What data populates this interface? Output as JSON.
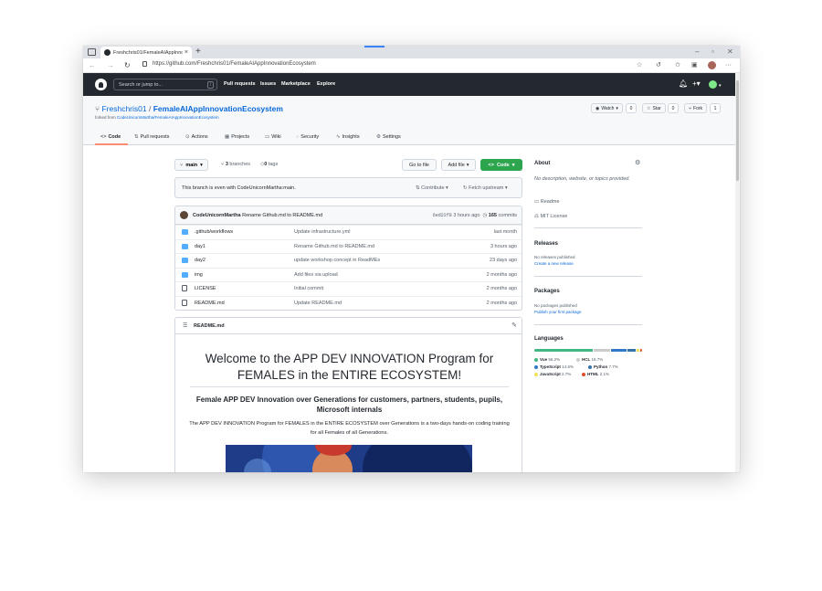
{
  "browser": {
    "tab_title": "Freshchris01/FemaleAIAppInno...",
    "url": "https://github.com/Freshchris01/FemaleAIAppInnovationEcosystem"
  },
  "gh": {
    "search_placeholder": "Search or jump to...",
    "search_key": "/",
    "nav": [
      "Pull requests",
      "Issues",
      "Marketplace",
      "Explore"
    ]
  },
  "repo": {
    "owner": "Freshchris01",
    "separator": "/",
    "name": "FemaleAIAppInnovationEcosystem",
    "forked_prefix": "forked from ",
    "forked_from": "CodeUnicornMartha/FemaleAIAppInnovationEcosystem",
    "watch_label": "Watch",
    "watch_count": "0",
    "star_label": "Star",
    "star_count": "0",
    "fork_label": "Fork",
    "fork_count": "1",
    "tabs": [
      "Code",
      "Pull requests",
      "Actions",
      "Projects",
      "Wiki",
      "Security",
      "Insights",
      "Settings"
    ]
  },
  "toolbar": {
    "branch": "main",
    "branches_count": "3",
    "branches_label": "branches",
    "tags_count": "0",
    "tags_label": "tags",
    "goto_file": "Go to file",
    "add_file": "Add file",
    "code": "Code"
  },
  "even": {
    "message": "This branch is even with CodeUnicornMartha:main.",
    "contribute": "Contribute",
    "fetch": "Fetch upstream"
  },
  "commit": {
    "author": "CodeUnicornMartha",
    "message": "Rename Github.md to README.md",
    "sha": "6ed22f8",
    "time": "3 hours ago",
    "count": "165",
    "count_label": "commits"
  },
  "files": [
    {
      "name": ".github/workflows",
      "type": "folder",
      "message": "Update infrastructure.yml",
      "age": "last month"
    },
    {
      "name": "day1",
      "type": "folder",
      "message": "Rename Github.md to README.md",
      "age": "3 hours ago"
    },
    {
      "name": "day2",
      "type": "folder",
      "message": "update workshop concept in ReadMEs",
      "age": "23 days ago"
    },
    {
      "name": "img",
      "type": "folder",
      "message": "Add files via upload",
      "age": "2 months ago"
    },
    {
      "name": "LICENSE",
      "type": "file",
      "message": "Initial commit",
      "age": "2 months ago"
    },
    {
      "name": "README.md",
      "type": "file",
      "message": "Update README.md",
      "age": "2 months ago"
    }
  ],
  "readme": {
    "filename": "README.md",
    "h1": "Welcome to the APP DEV INNOVATION Program for FEMALES in the ENTIRE ECOSYSTEM!",
    "h2": "Female APP DEV Innovation over Generations for customers, partners, students, pupils, Microsoft internals",
    "paragraph": "The APP DEV INNOVATION Program for FEMALES in the ENTIRE ECOSYSTEM over Generations is a two-days hands-on coding training for all Females of all Generations."
  },
  "sidebar": {
    "about_title": "About",
    "about_desc": "No description, website, or topics provided.",
    "readme_link": "Readme",
    "license_link": "MIT License",
    "releases_title": "Releases",
    "releases_none": "No releases published",
    "releases_create": "Create a new release",
    "packages_title": "Packages",
    "packages_none": "No packages published",
    "packages_publish": "Publish your first package",
    "languages_title": "Languages",
    "languages": [
      {
        "name": "Vue",
        "percent": "56.2%",
        "value": 56.2,
        "color": "#41b883"
      },
      {
        "name": "HCL",
        "percent": "16.7%",
        "value": 16.7,
        "color": "#cccccc"
      },
      {
        "name": "TypeScript",
        "percent": "14.6%",
        "value": 14.6,
        "color": "#3178c6"
      },
      {
        "name": "Python",
        "percent": "7.7%",
        "value": 7.7,
        "color": "#3572a5"
      },
      {
        "name": "JavaScript",
        "percent": "2.7%",
        "value": 2.7,
        "color": "#f1e05a"
      },
      {
        "name": "HTML",
        "percent": "2.1%",
        "value": 2.1,
        "color": "#e34c26"
      }
    ]
  }
}
